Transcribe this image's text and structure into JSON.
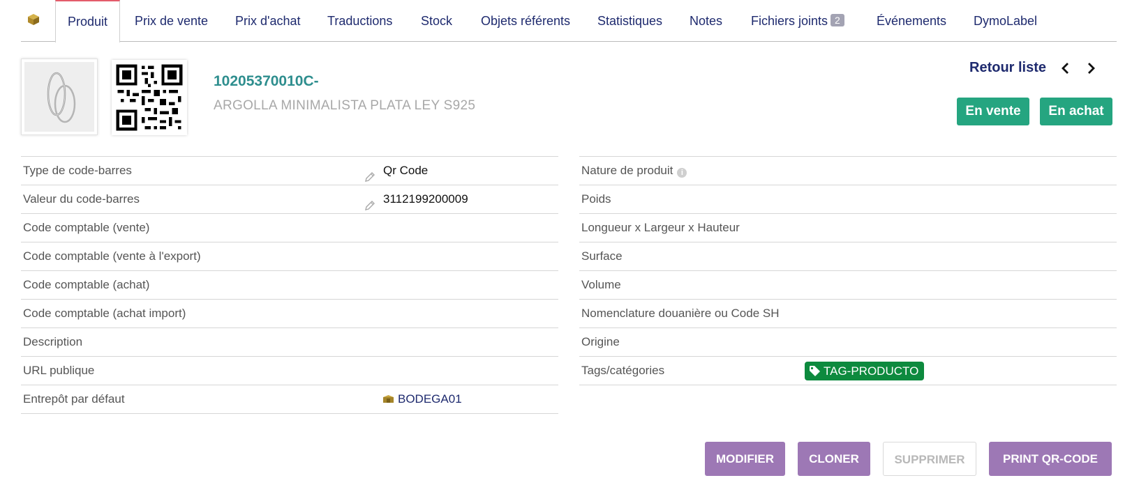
{
  "tabs": {
    "home_icon": "cube-icon",
    "items": [
      {
        "label": "Produit"
      },
      {
        "label": "Prix de vente"
      },
      {
        "label": "Prix d'achat"
      },
      {
        "label": "Traductions"
      },
      {
        "label": "Stock"
      },
      {
        "label": "Objets référents"
      },
      {
        "label": "Statistiques"
      },
      {
        "label": "Notes"
      },
      {
        "label": "Fichiers joints",
        "badge": "2"
      },
      {
        "label": "Événements"
      },
      {
        "label": "DymoLabel"
      }
    ],
    "active": "Produit"
  },
  "product": {
    "ref": "10205370010C-",
    "label": "ARGOLLA MINIMALISTA PLATA LEY S925",
    "photo_icon": "ring-photo",
    "qr_icon": "qr-code-icon"
  },
  "nav": {
    "back_label": "Retour liste",
    "prev_icon": "chevron-left-icon",
    "next_icon": "chevron-right-icon"
  },
  "status": {
    "on_sale_label": "En vente",
    "on_purchase_label": "En achat",
    "color": "#25a580"
  },
  "left_fields": [
    {
      "label": "Type de code-barres",
      "value": "Qr Code",
      "editable": true
    },
    {
      "label": "Valeur du code-barres",
      "value": "3112199200009",
      "editable": true
    },
    {
      "label": "Code comptable (vente)",
      "value": ""
    },
    {
      "label": "Code comptable (vente à l'export)",
      "value": ""
    },
    {
      "label": "Code comptable (achat)",
      "value": ""
    },
    {
      "label": "Code comptable (achat import)",
      "value": ""
    },
    {
      "label": "Description",
      "value": ""
    },
    {
      "label": "URL publique",
      "value": ""
    },
    {
      "label": "Entrepôt par défaut",
      "value": "BODEGA01",
      "icon": "warehouse-icon"
    }
  ],
  "right_fields": [
    {
      "label": "Nature de produit",
      "value": "",
      "info": true
    },
    {
      "label": "Poids",
      "value": ""
    },
    {
      "label": "Longueur x Largeur x Hauteur",
      "value": ""
    },
    {
      "label": "Surface",
      "value": ""
    },
    {
      "label": "Volume",
      "value": ""
    },
    {
      "label": "Nomenclature douanière ou Code SH",
      "value": ""
    },
    {
      "label": "Origine",
      "value": ""
    },
    {
      "label": "Tags/catégories",
      "value": "TAG-PRODUCTO",
      "tag_color": "#0d8a3e"
    }
  ],
  "actions": {
    "modify": "MODIFIER",
    "clone": "CLONER",
    "delete": "SUPPRIMER",
    "print": "PRINT QR-CODE",
    "accent": "#9d78b5"
  }
}
